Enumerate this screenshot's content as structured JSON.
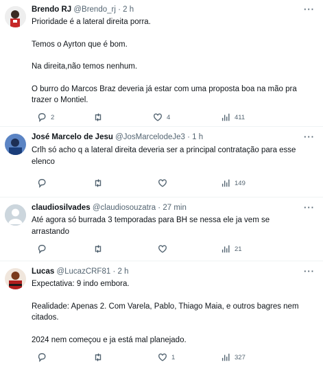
{
  "tweets": [
    {
      "name": "Brendo RJ",
      "handle": "@Brendo_rj",
      "sep": "·",
      "time": "2 h",
      "paragraphs": [
        "Prioridade é a lateral direita porra.",
        "Temos o Ayrton que é bom.",
        "Na direita,não temos nenhum.",
        "O burro do Marcos Braz deveria já estar com uma proposta boa na mão pra trazer o Montiel."
      ],
      "replies": "2",
      "retweets": "",
      "likes": "4",
      "views": "411",
      "avatar_colors": [
        "#2a2a2a",
        "#e9e9e9"
      ]
    },
    {
      "name": "José Marcelo de Jesu",
      "handle": "@JosMarcelodeJe3",
      "sep": "·",
      "time": "1 h",
      "paragraphs": [
        "Crlh só acho q a lateral direita deveria ser a principal contratação para esse elenco"
      ],
      "replies": "",
      "retweets": "",
      "likes": "",
      "views": "149",
      "avatar_colors": [
        "#2c4b8a",
        "#7fa6d6"
      ]
    },
    {
      "name": "claudiosilvades",
      "handle": "@claudiosouzatra",
      "sep": "·",
      "time": "27 min",
      "paragraphs": [
        "Até agora só burrada 3 temporadas para BH se nessa ele ja vem se arrastando"
      ],
      "replies": "",
      "retweets": "",
      "likes": "",
      "views": "21",
      "avatar_colors": [
        "#ccd6dd",
        "#ffffff"
      ]
    },
    {
      "name": "Lucas",
      "handle": "@LucazCRF81",
      "sep": "·",
      "time": "2 h",
      "paragraphs": [
        "Expectativa: 9 indo embora.",
        "Realidade: Apenas 2. Com Varela, Pablo, Thiago Maia, e  outros bagres nem citados.",
        "2024 nem começou e ja está mal planejado."
      ],
      "replies": "",
      "retweets": "",
      "likes": "1",
      "views": "327",
      "avatar_colors": [
        "#8a1c1c",
        "#d8a47a"
      ]
    }
  ],
  "more_label": "···"
}
